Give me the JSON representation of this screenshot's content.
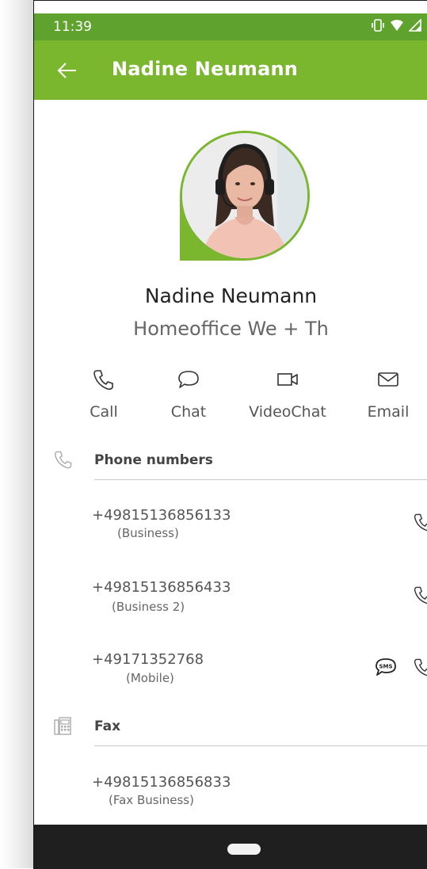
{
  "status": {
    "time": "11:39"
  },
  "appbar": {
    "title": "Nadine Neumann"
  },
  "profile": {
    "name": "Nadine Neumann",
    "status_text": "Homeoffice We + Th"
  },
  "actions": [
    {
      "label": "Call",
      "icon": "phone-icon"
    },
    {
      "label": "Chat",
      "icon": "chat-bubble-icon"
    },
    {
      "label": "VideoChat",
      "icon": "video-icon"
    },
    {
      "label": "Email",
      "icon": "envelope-icon"
    }
  ],
  "sections": {
    "phone": {
      "title": "Phone numbers",
      "entries": [
        {
          "number": "+49815136856133",
          "type": "(Business)"
        },
        {
          "number": "+49815136856433",
          "type": "(Business 2)"
        },
        {
          "number": "+49171352768",
          "type": "(Mobile)",
          "sms_label": "SMS"
        }
      ]
    },
    "fax": {
      "title": "Fax",
      "entries": [
        {
          "number": "+49815136856833",
          "type": "(Fax Business)"
        }
      ]
    }
  },
  "colors": {
    "statusbar": "#5fa22e",
    "appbar": "#7ab72f",
    "accent": "#7ab72f",
    "navbar": "#1f1f1f"
  }
}
